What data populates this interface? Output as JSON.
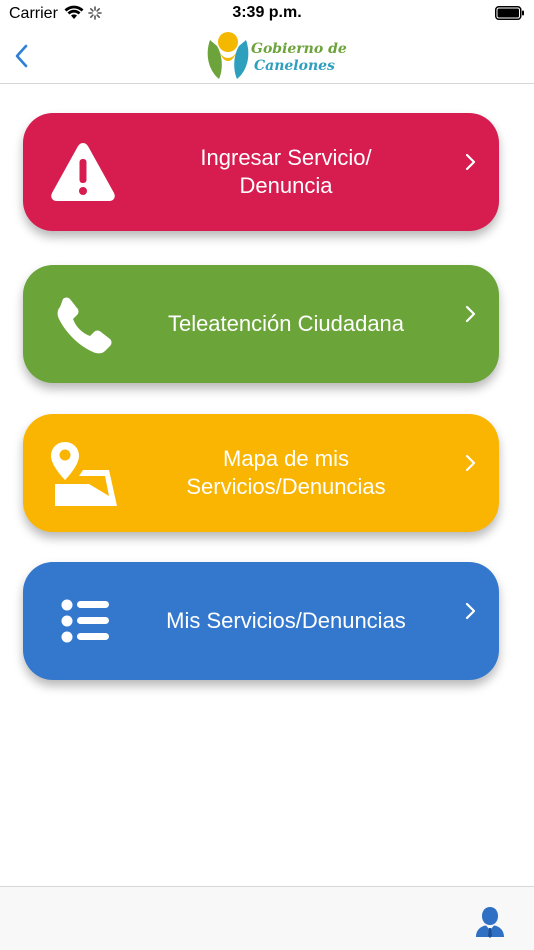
{
  "status_bar": {
    "carrier": "Carrier",
    "time": "3:39 p.m."
  },
  "nav": {
    "back_icon": "chevron-left-icon",
    "logo_line1": "Gobierno de",
    "logo_line2": "Canelones",
    "accent_color": "#2f7fd8"
  },
  "menu": [
    {
      "label": "Ingresar Servicio/\nDenuncia",
      "icon": "warning-triangle-icon",
      "color": "#d71c50"
    },
    {
      "label": "Teleatención Ciudadana",
      "icon": "phone-icon",
      "color": "#6ba439"
    },
    {
      "label": "Mapa de mis\nServicios/Denuncias",
      "icon": "map-pin-icon",
      "color": "#f9b502"
    },
    {
      "label": "Mis Servicios/Denuncias",
      "icon": "list-icon",
      "color": "#3478ce"
    }
  ],
  "footer": {
    "profile_icon": "user-profile-icon",
    "profile_color": "#2f6fc4"
  }
}
